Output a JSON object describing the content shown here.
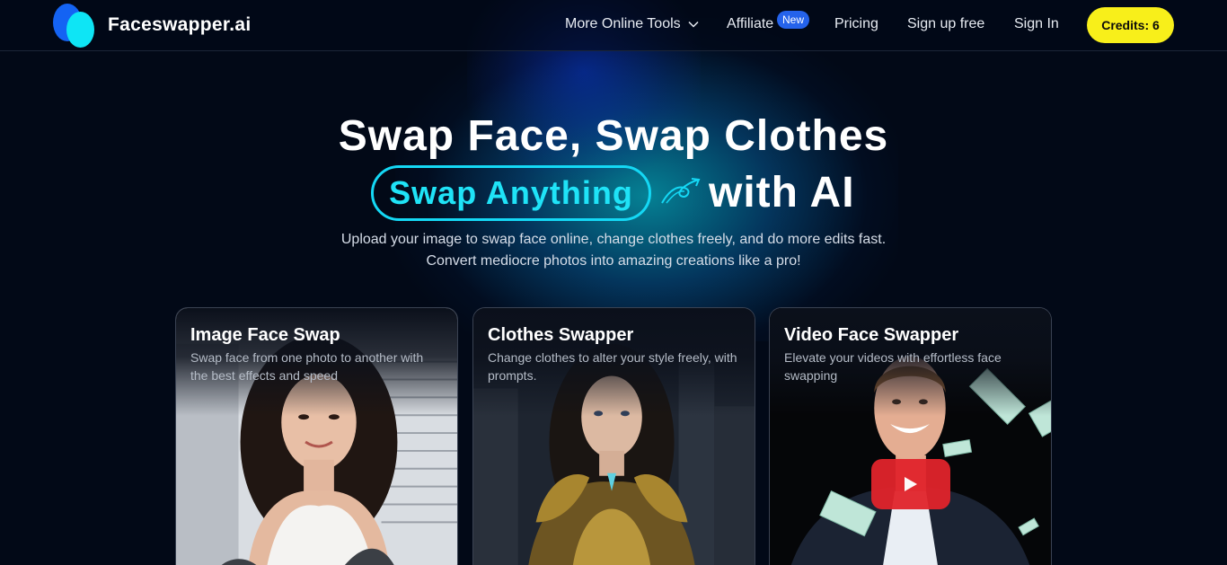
{
  "header": {
    "brand": "Faceswapper.ai",
    "nav": {
      "more_tools": "More Online Tools",
      "affiliate": "Affiliate",
      "affiliate_badge": "New",
      "pricing": "Pricing",
      "signup": "Sign up free",
      "signin": "Sign In"
    },
    "credits": "Credits: 6"
  },
  "hero": {
    "line1": "Swap Face, Swap Clothes",
    "highlight": "Swap Anything",
    "line2_tail": "with AI",
    "subtitle_1": "Upload your image to swap face online, change clothes freely, and do more edits fast.",
    "subtitle_2": "Convert mediocre photos into amazing creations like a pro!"
  },
  "cards": [
    {
      "title": "Image Face Swap",
      "desc": "Swap face from one photo to another with the best effects and speed"
    },
    {
      "title": "Clothes Swapper",
      "desc": "Change clothes to alter your style freely, with prompts."
    },
    {
      "title": "Video Face Swapper",
      "desc": "Elevate your videos with effortless face swapping"
    }
  ],
  "colors": {
    "background": "#020917",
    "accent_cyan": "#14d8f5",
    "credits_yellow": "#f8ef1a",
    "badge_blue": "#2563eb",
    "play_red": "#e1242b"
  }
}
